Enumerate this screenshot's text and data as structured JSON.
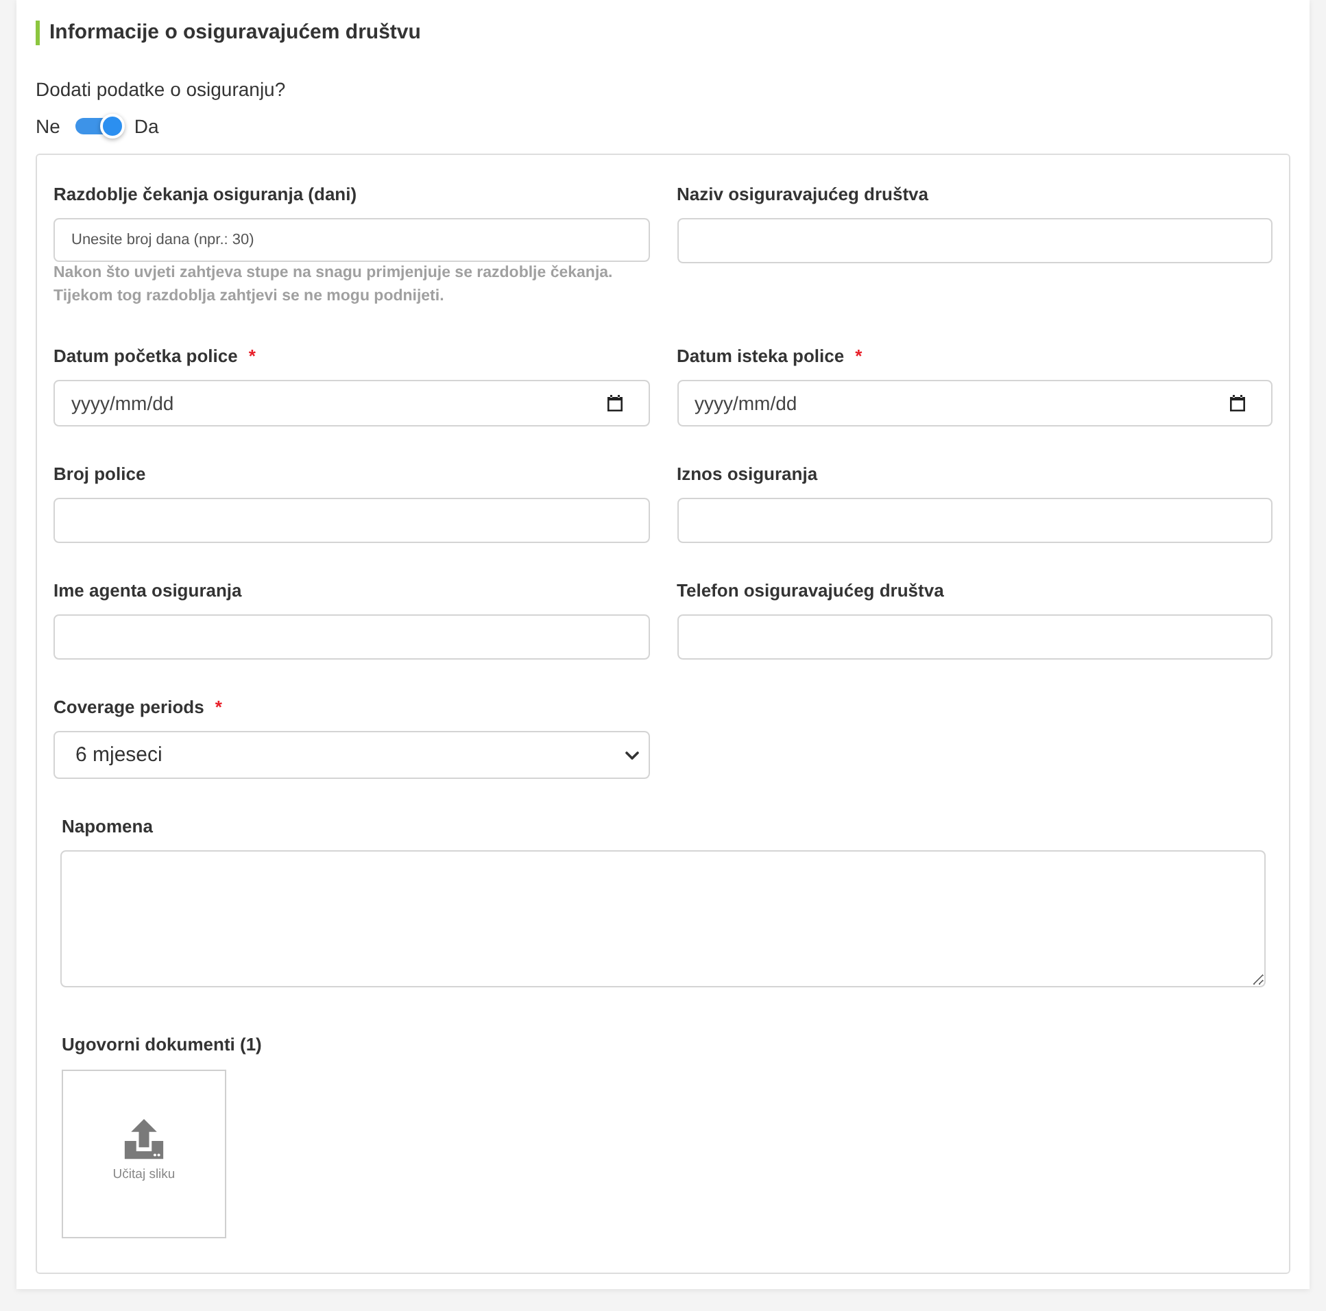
{
  "section": {
    "title": "Informacije o osiguravajućem društvu"
  },
  "insurance_toggle": {
    "question": "Dodati podatke o osiguranju?",
    "off_label": "Ne",
    "on_label": "Da",
    "on": true
  },
  "fields": [
    {
      "kind": "text",
      "label": "Razdoblje čekanja osiguranja (dani)",
      "placeholder": "Unesite broj dana (npr.: 30)",
      "help": [
        "Nakon što uvjeti zahtjeva stupe na snagu primjenjuje se razdoblje čekanja.",
        "Tijekom tog razdoblja zahtjevi se ne mogu podnijeti."
      ]
    },
    {
      "kind": "text",
      "label": "Naziv osiguravajućeg društva"
    },
    {
      "kind": "date",
      "label": "Datum početka police",
      "required_mark": "*",
      "placeholder": "yyyy/mm/dd"
    },
    {
      "kind": "date",
      "label": "Datum isteka police",
      "required_mark": "*",
      "placeholder": "yyyy/mm/dd"
    },
    {
      "kind": "text",
      "label": "Broj police"
    },
    {
      "kind": "text",
      "label": "Iznos osiguranja"
    },
    {
      "kind": "text",
      "label": "Ime agenta osiguranja"
    },
    {
      "kind": "text",
      "label": "Telefon osiguravajućeg društva"
    },
    {
      "kind": "select",
      "label": "Coverage periods",
      "required_mark": "*",
      "value": "6 mjeseci"
    }
  ],
  "note": {
    "label": "Napomena"
  },
  "documents": {
    "label": "Ugovorni dokumenti (1)",
    "upload_label": "Učitaj sliku"
  }
}
